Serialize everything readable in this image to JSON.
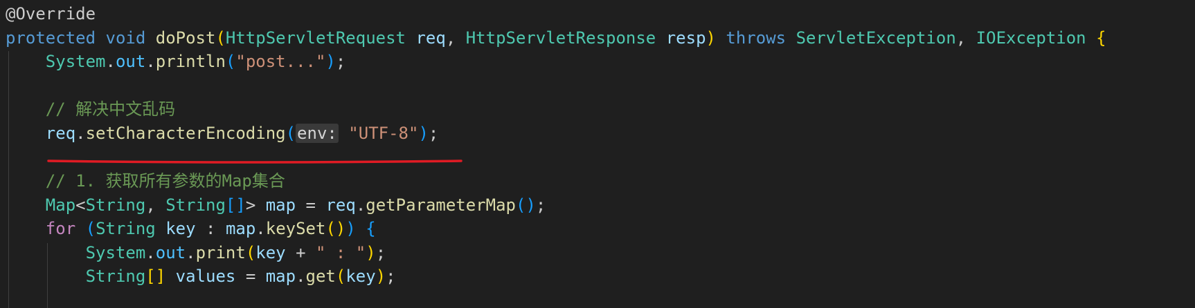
{
  "code": {
    "annotation": "@Override",
    "l2": {
      "kw_protected": "protected",
      "kw_void": "void",
      "method": "doPost",
      "paren_open": "(",
      "type_req": "HttpServletRequest",
      "param_req": "req",
      "comma1": ",",
      "type_resp": "HttpServletResponse",
      "param_resp": "resp",
      "paren_close": ")",
      "kw_throws": "throws",
      "exc1": "ServletException",
      "comma2": ",",
      "exc2": "IOException",
      "brace_open": "{"
    },
    "l3": {
      "system": "System",
      "dot1": ".",
      "out": "out",
      "dot2": ".",
      "println": "println",
      "po": "(",
      "str": "\"post...\"",
      "pc": ")",
      "semi": ";"
    },
    "l5": {
      "comment": "// 解决中文乱码"
    },
    "l6": {
      "req": "req",
      "dot": ".",
      "method": "setCharacterEncoding",
      "po": "(",
      "hint": "env:",
      "str": "\"UTF-8\"",
      "pc": ")",
      "semi": ";"
    },
    "l8": {
      "comment": "// 1. 获取所有参数的Map集合"
    },
    "l9": {
      "map_type": "Map",
      "lt": "<",
      "string1": "String",
      "comma": ",",
      "string2": "String",
      "arr": "[]",
      "gt": ">",
      "var_map": "map",
      "eq": "=",
      "req": "req",
      "dot": ".",
      "method": "getParameterMap",
      "parens": "()",
      "semi": ";"
    },
    "l10": {
      "kw_for": "for",
      "po": "(",
      "string": "String",
      "key": "key",
      "colon": ":",
      "map": "map",
      "dot": ".",
      "keyset": "keySet",
      "parens": "()",
      "pc": ")",
      "brace": "{"
    },
    "l11": {
      "system": "System",
      "dot1": ".",
      "out": "out",
      "dot2": ".",
      "print": "print",
      "po": "(",
      "key": "key",
      "plus": "+",
      "str": "\" : \"",
      "pc": ")",
      "semi": ";"
    },
    "l12": {
      "string": "String",
      "arr": "[]",
      "values": "values",
      "eq": "=",
      "map": "map",
      "dot": ".",
      "get": "get",
      "po": "(",
      "key": "key",
      "pc": ")",
      "semi": ";"
    }
  },
  "colors": {
    "background": "#1f1f1f",
    "underline": "#e01b24"
  }
}
